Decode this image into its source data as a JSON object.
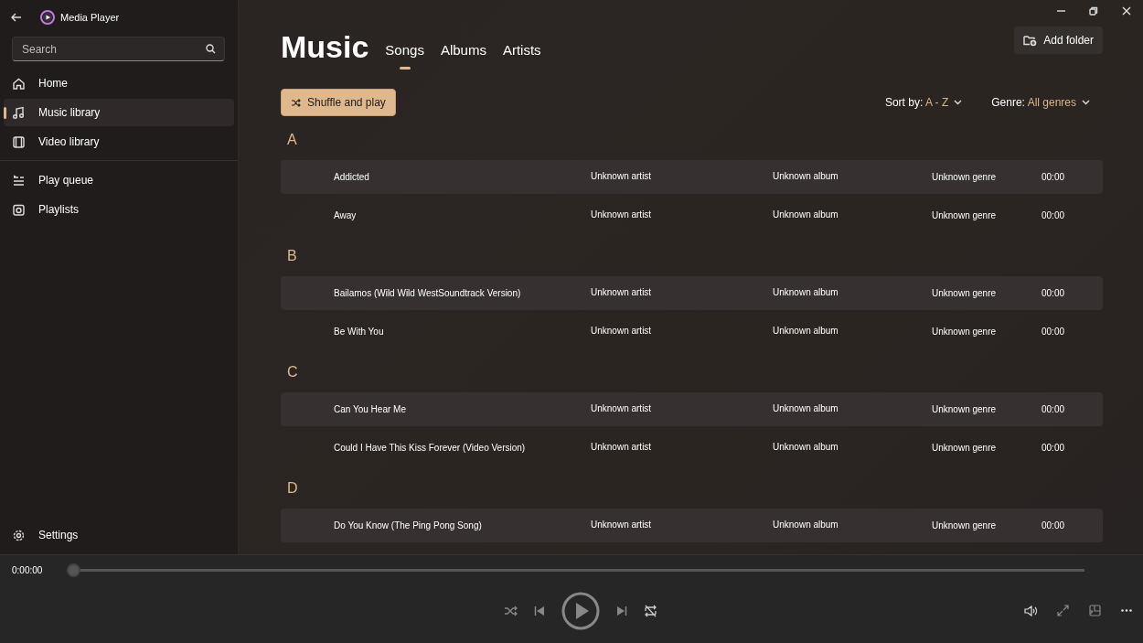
{
  "window": {
    "title": "Media Player"
  },
  "search": {
    "placeholder": "Search"
  },
  "nav": [
    {
      "label": "Home",
      "kind": "home",
      "selected": false
    },
    {
      "label": "Music library",
      "kind": "music",
      "selected": true
    },
    {
      "label": "Video library",
      "kind": "video",
      "selected": false
    },
    {
      "label": "Play queue",
      "kind": "queue",
      "selected": false,
      "divider_before": true
    },
    {
      "label": "Playlists",
      "kind": "playlist",
      "selected": false
    }
  ],
  "settings": {
    "label": "Settings"
  },
  "page_title": "Music",
  "tabs": [
    {
      "label": "Songs",
      "selected": true
    },
    {
      "label": "Albums",
      "selected": false
    },
    {
      "label": "Artists",
      "selected": false
    }
  ],
  "add_folder": "Add folder",
  "shuffle_button": "Shuffle and play",
  "sort": {
    "label": "Sort by:",
    "value": "A - Z"
  },
  "genre": {
    "label": "Genre:",
    "value": "All genres"
  },
  "groups": [
    {
      "letter": "A",
      "songs": [
        {
          "title": "Addicted",
          "artist": "Unknown artist",
          "album": "Unknown album",
          "genre": "Unknown genre",
          "duration": "00:00"
        },
        {
          "title": "Away",
          "artist": "Unknown artist",
          "album": "Unknown album",
          "genre": "Unknown genre",
          "duration": "00:00"
        }
      ]
    },
    {
      "letter": "B",
      "songs": [
        {
          "title": "Bailamos (Wild Wild WestSoundtrack Version)",
          "artist": "Unknown artist",
          "album": "Unknown album",
          "genre": "Unknown genre",
          "duration": "00:00"
        },
        {
          "title": "Be With You",
          "artist": "Unknown artist",
          "album": "Unknown album",
          "genre": "Unknown genre",
          "duration": "00:00"
        }
      ]
    },
    {
      "letter": "C",
      "songs": [
        {
          "title": "Can You Hear Me",
          "artist": "Unknown artist",
          "album": "Unknown album",
          "genre": "Unknown genre",
          "duration": "00:00"
        },
        {
          "title": "Could I Have This Kiss Forever (Video Version)",
          "artist": "Unknown artist",
          "album": "Unknown album",
          "genre": "Unknown genre",
          "duration": "00:00"
        }
      ]
    },
    {
      "letter": "D",
      "songs": [
        {
          "title": "Do You Know (The Ping Pong Song)",
          "artist": "Unknown artist",
          "album": "Unknown album",
          "genre": "Unknown genre",
          "duration": "00:00"
        }
      ]
    }
  ],
  "player": {
    "elapsed": "0:00:00",
    "level": 0
  }
}
